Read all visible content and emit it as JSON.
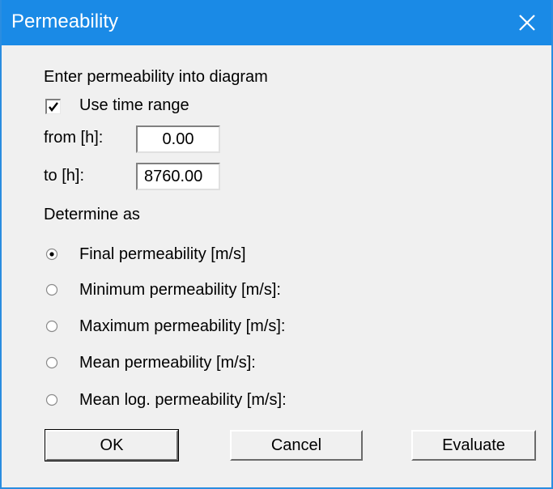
{
  "window": {
    "title": "Permeability"
  },
  "group_label": "Enter permeability into diagram",
  "use_time_range": {
    "label": "Use time range",
    "checked": true
  },
  "from": {
    "label": "from [h]:",
    "value": "0.00"
  },
  "to": {
    "label": "to [h]:",
    "value": "8760.00"
  },
  "determine_label": "Determine as",
  "options": [
    {
      "label": "Final permeability [m/s]",
      "selected": true
    },
    {
      "label": "Minimum permeability [m/s]:",
      "selected": false
    },
    {
      "label": "Maximum permeability [m/s]:",
      "selected": false
    },
    {
      "label": "Mean permeability [m/s]:",
      "selected": false
    },
    {
      "label": "Mean log. permeability [m/s]:",
      "selected": false
    }
  ],
  "buttons": {
    "ok": "OK",
    "cancel": "Cancel",
    "evaluate": "Evaluate"
  },
  "colors": {
    "titlebar": "#1a8ae6",
    "dialog_bg": "#f0f0f0"
  }
}
